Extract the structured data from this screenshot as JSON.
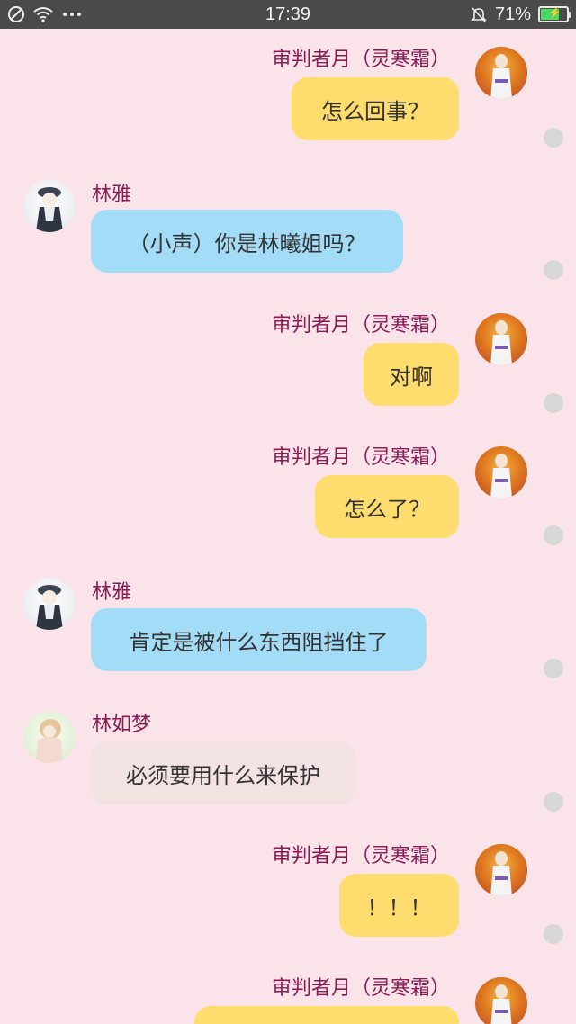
{
  "status_bar": {
    "time": "17:39",
    "battery_percent": "71%",
    "left_icons": [
      "no-sim-icon",
      "wifi-icon",
      "more-dots-icon"
    ],
    "right_icons": [
      "mute-bell-icon",
      "battery-icon"
    ]
  },
  "messages": [
    {
      "side": "right",
      "sender": "审判者月（灵寒霜）",
      "text": "怎么回事？",
      "color": "#ffdc6e"
    },
    {
      "side": "left",
      "sender": "林雅",
      "text": "（小声）你是林曦姐吗？",
      "color": "#a3dcf7"
    },
    {
      "side": "right",
      "sender": "审判者月（灵寒霜）",
      "text": "对啊",
      "color": "#ffdc6e"
    },
    {
      "side": "right",
      "sender": "审判者月（灵寒霜）",
      "text": "怎么了？",
      "color": "#ffdc6e"
    },
    {
      "side": "left",
      "sender": "林雅",
      "text": "肯定是被什么东西阻挡住了",
      "color": "#a3dcf7"
    },
    {
      "side": "left",
      "sender": "林如梦",
      "text": "必须要用什么来保护",
      "color": "#f3e2e2"
    },
    {
      "side": "right",
      "sender": "审判者月（灵寒霜）",
      "text": "！！！",
      "color": "#ffdc6e"
    },
    {
      "side": "right",
      "sender": "审判者月（灵寒霜）",
      "text": "",
      "color": "#ffdc6e"
    }
  ]
}
